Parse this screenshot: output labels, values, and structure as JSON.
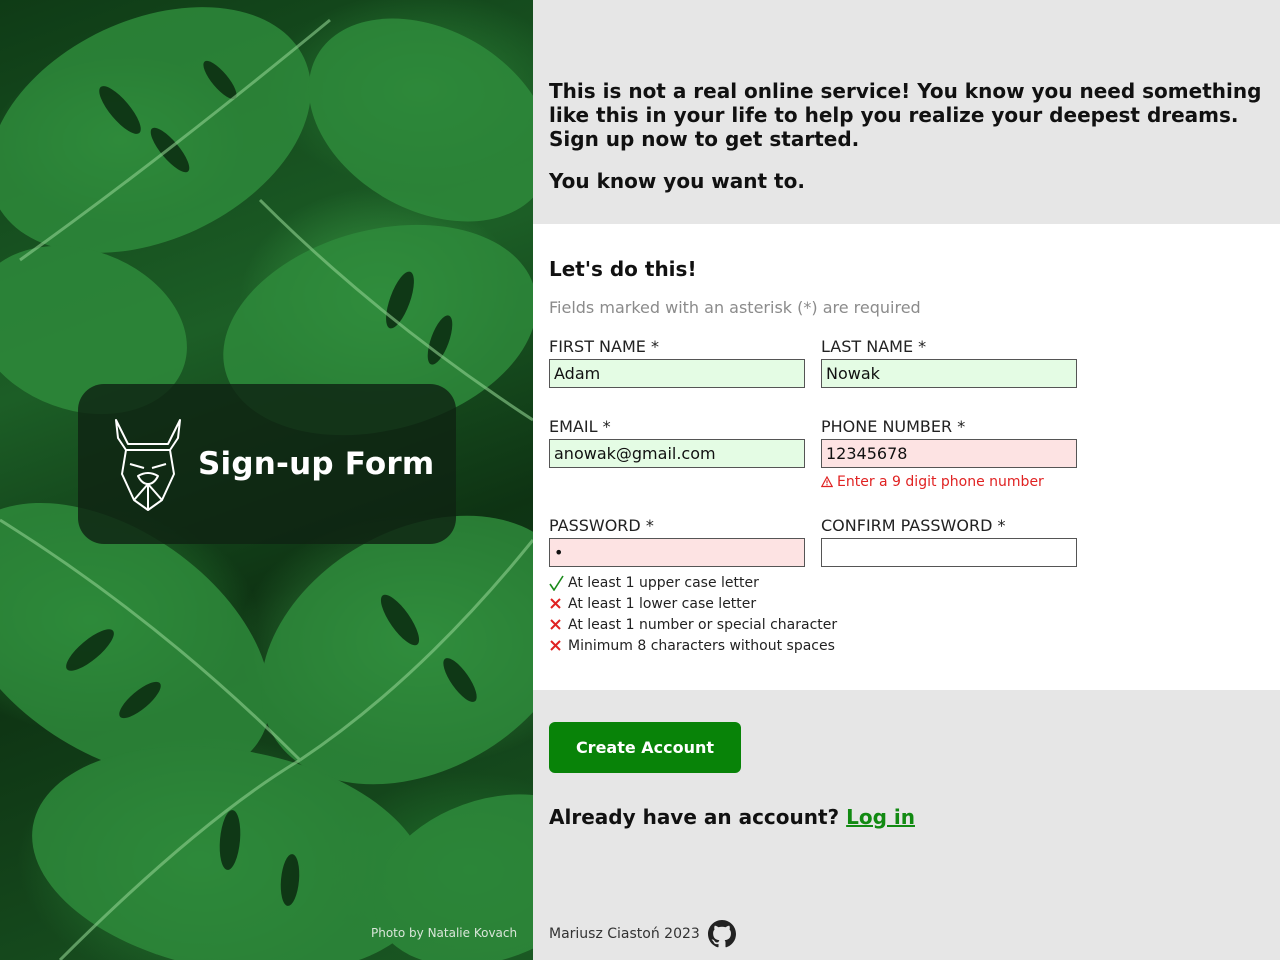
{
  "hero": {
    "brand_title": "Sign-up Form",
    "logo_icon": "viking-helmet-icon",
    "photo_credit": "Photo by Natalie Kovach"
  },
  "intro": {
    "paragraph1": "This is not a real online service! You know you need something like this in your life to help you realize your deepest dreams. Sign up now to get started.",
    "paragraph2": "You know you want to."
  },
  "form": {
    "title": "Let's do this!",
    "note": "Fields marked with an asterisk (*) are required",
    "fields": {
      "first_name": {
        "label": "FIRST NAME *",
        "value": "Adam",
        "state": "valid"
      },
      "last_name": {
        "label": "LAST NAME *",
        "value": "Nowak",
        "state": "valid"
      },
      "email": {
        "label": "EMAIL *",
        "value": "anowak@gmail.com",
        "state": "valid"
      },
      "phone": {
        "label": "PHONE NUMBER *",
        "value": "12345678",
        "state": "invalid"
      },
      "password": {
        "label": "PASSWORD *",
        "value": "•",
        "state": "invalid"
      },
      "confirm_password": {
        "label": "CONFIRM PASSWORD *",
        "value": "",
        "state": "empty"
      }
    },
    "phone_error": "Enter a 9 digit phone number",
    "password_rules": [
      {
        "text": "At least 1 upper case letter",
        "met": true
      },
      {
        "text": "At least 1 lower case letter",
        "met": false
      },
      {
        "text": "At least 1 number or special character",
        "met": false
      },
      {
        "text": "Minimum 8 characters without spaces",
        "met": false
      }
    ]
  },
  "actions": {
    "create_label": "Create Account",
    "login_prompt": "Already have an account?",
    "login_link": "Log in"
  },
  "footer": {
    "author": "Mariusz Ciastoń 2023",
    "icon": "github-icon"
  },
  "colors": {
    "accent_green": "#088308",
    "valid_bg": "#e4fce4",
    "invalid_bg": "#fde3e3",
    "error_red": "#e02222"
  }
}
